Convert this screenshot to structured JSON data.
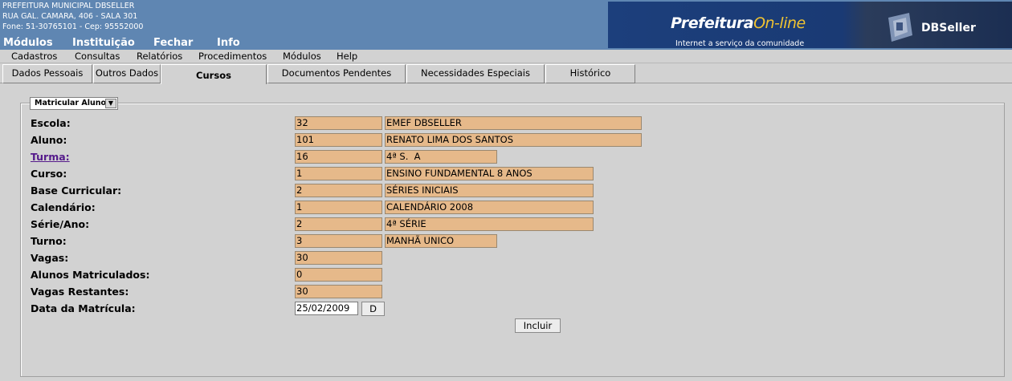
{
  "header": {
    "org_name": "PREFEITURA MUNICIPAL DBSELLER",
    "address": "RUA GAL. CAMARA, 406 - SALA 301",
    "phone": "Fone: 51-30765101  -  Cep: 95552000",
    "top_menu": [
      "Módulos",
      "Instituição",
      "Fechar",
      "Info"
    ],
    "banner": {
      "brand": "Prefeitura",
      "brand_accent": "On-line",
      "tagline": "Internet a serviço da comunidade",
      "company": "DBSeller"
    }
  },
  "menubar": [
    "Cadastros",
    "Consultas",
    "Relatórios",
    "Procedimentos",
    "Módulos",
    "Help"
  ],
  "tabs": [
    {
      "label": "Dados Pessoais"
    },
    {
      "label": "Outros Dados"
    },
    {
      "label": "Cursos",
      "active": true
    },
    {
      "label": "Documentos Pendentes"
    },
    {
      "label": "Necessidades Especiais"
    },
    {
      "label": "Histórico"
    }
  ],
  "form": {
    "legend_select": "Matricular Aluno",
    "rows": [
      {
        "label": "Escola:",
        "code": "32",
        "desc": "EMEF DBSELLER"
      },
      {
        "label": "Aluno:",
        "code": "101",
        "desc": "RENATO LIMA DOS SANTOS"
      },
      {
        "label": "Turma:",
        "code": "16",
        "desc": "4ª S.  A"
      },
      {
        "label": "Curso:",
        "code": "1",
        "desc": "ENSINO FUNDAMENTAL 8 ANOS"
      },
      {
        "label": "Base Curricular:",
        "code": "2",
        "desc": "SÉRIES INICIAIS"
      },
      {
        "label": "Calendário:",
        "code": "1",
        "desc": "CALENDÁRIO 2008"
      },
      {
        "label": "Série/Ano:",
        "code": "2",
        "desc": "4ª SÉRIE"
      },
      {
        "label": "Turno:",
        "code": "3",
        "desc": "MANHÃ UNICO"
      },
      {
        "label": "Vagas:",
        "code": "30"
      },
      {
        "label": "Alunos Matriculados:",
        "code": "0"
      },
      {
        "label": "Vagas Restantes:",
        "code": "30"
      },
      {
        "label": "Data da Matrícula:",
        "date": "25/02/2009",
        "date_button": "D"
      }
    ],
    "submit_label": "Incluir"
  },
  "colors": {
    "header_bg": "#5f86b2",
    "field_bg": "#e6b98a",
    "page_bg": "#d2d2d2",
    "link": "#551a8b"
  }
}
